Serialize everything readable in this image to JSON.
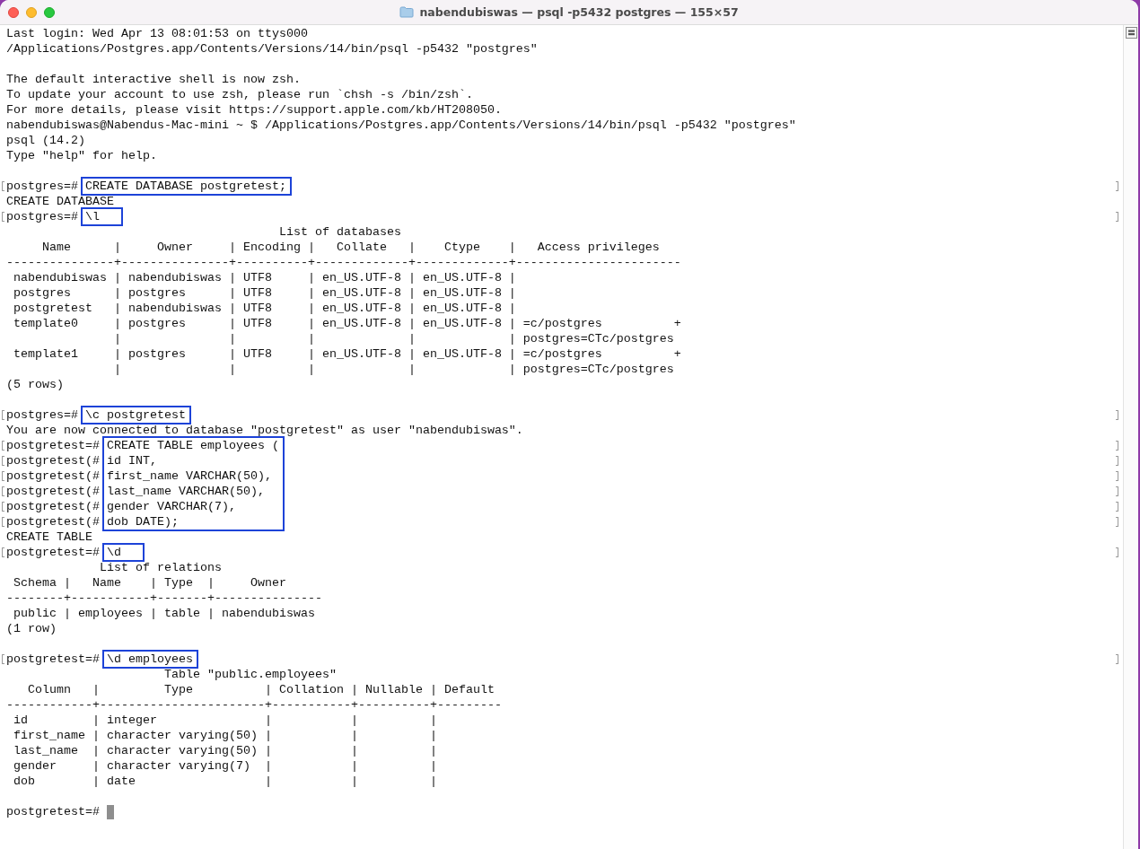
{
  "window": {
    "title": "nabendubiswas — psql -p5432 postgres — 155×57"
  },
  "lines": [
    {
      "kind": "output",
      "text": "Last login: Wed Apr 13 08:01:53 on ttys000"
    },
    {
      "kind": "output",
      "text": "/Applications/Postgres.app/Contents/Versions/14/bin/psql -p5432 \"postgres\""
    },
    {
      "kind": "blank"
    },
    {
      "kind": "output",
      "text": "The default interactive shell is now zsh."
    },
    {
      "kind": "output",
      "text": "To update your account to use zsh, please run `chsh -s /bin/zsh`."
    },
    {
      "kind": "output",
      "text": "For more details, please visit https://support.apple.com/kb/HT208050."
    },
    {
      "kind": "output",
      "text": "nabendubiswas@Nabendus-Mac-mini ~ $ /Applications/Postgres.app/Contents/Versions/14/bin/psql -p5432 \"postgres\""
    },
    {
      "kind": "output",
      "text": "psql (14.2)"
    },
    {
      "kind": "output",
      "text": "Type \"help\" for help."
    },
    {
      "kind": "blank"
    },
    {
      "kind": "command",
      "boxed": true,
      "rows": [
        {
          "prompt": "postgres=#",
          "input": "CREATE DATABASE postgretest;"
        }
      ]
    },
    {
      "kind": "output",
      "text": "CREATE DATABASE"
    },
    {
      "kind": "command",
      "boxed": true,
      "rows": [
        {
          "prompt": "postgres=#",
          "input": "\\l"
        }
      ]
    },
    {
      "kind": "output",
      "text": "                                      List of databases"
    },
    {
      "kind": "output",
      "text": "     Name      |     Owner     | Encoding |   Collate   |    Ctype    |   Access privileges"
    },
    {
      "kind": "output",
      "text": "---------------+---------------+----------+-------------+-------------+-----------------------"
    },
    {
      "kind": "output",
      "text": " nabendubiswas | nabendubiswas | UTF8     | en_US.UTF-8 | en_US.UTF-8 |"
    },
    {
      "kind": "output",
      "text": " postgres      | postgres      | UTF8     | en_US.UTF-8 | en_US.UTF-8 |"
    },
    {
      "kind": "output",
      "text": " postgretest   | nabendubiswas | UTF8     | en_US.UTF-8 | en_US.UTF-8 |"
    },
    {
      "kind": "output",
      "text": " template0     | postgres      | UTF8     | en_US.UTF-8 | en_US.UTF-8 | =c/postgres          +"
    },
    {
      "kind": "output",
      "text": "               |               |          |             |             | postgres=CTc/postgres"
    },
    {
      "kind": "output",
      "text": " template1     | postgres      | UTF8     | en_US.UTF-8 | en_US.UTF-8 | =c/postgres          +"
    },
    {
      "kind": "output",
      "text": "               |               |          |             |             | postgres=CTc/postgres"
    },
    {
      "kind": "output",
      "text": "(5 rows)"
    },
    {
      "kind": "blank"
    },
    {
      "kind": "command",
      "boxed": true,
      "rows": [
        {
          "prompt": "postgres=#",
          "input": "\\c postgretest"
        }
      ]
    },
    {
      "kind": "output",
      "text": "You are now connected to database \"postgretest\" as user \"nabendubiswas\"."
    },
    {
      "kind": "command",
      "boxed": true,
      "rows": [
        {
          "prompt": "postgretest=#",
          "input": "CREATE TABLE employees ("
        },
        {
          "prompt": "postgretest(#",
          "input": "id INT,"
        },
        {
          "prompt": "postgretest(#",
          "input": "first_name VARCHAR(50),"
        },
        {
          "prompt": "postgretest(#",
          "input": "last_name VARCHAR(50),"
        },
        {
          "prompt": "postgretest(#",
          "input": "gender VARCHAR(7),"
        },
        {
          "prompt": "postgretest(#",
          "input": "dob DATE);"
        }
      ]
    },
    {
      "kind": "output",
      "text": "CREATE TABLE"
    },
    {
      "kind": "command",
      "boxed": true,
      "rows": [
        {
          "prompt": "postgretest=#",
          "input": "\\d"
        }
      ]
    },
    {
      "kind": "output",
      "text": "             List of relations"
    },
    {
      "kind": "output",
      "text": " Schema |   Name    | Type  |     Owner"
    },
    {
      "kind": "output",
      "text": "--------+-----------+-------+---------------"
    },
    {
      "kind": "output",
      "text": " public | employees | table | nabendubiswas"
    },
    {
      "kind": "output",
      "text": "(1 row)"
    },
    {
      "kind": "blank"
    },
    {
      "kind": "command",
      "boxed": true,
      "rows": [
        {
          "prompt": "postgretest=#",
          "input": "\\d employees"
        }
      ]
    },
    {
      "kind": "output",
      "text": "                      Table \"public.employees\""
    },
    {
      "kind": "output",
      "text": "   Column   |         Type          | Collation | Nullable | Default"
    },
    {
      "kind": "output",
      "text": "------------+-----------------------+-----------+----------+---------"
    },
    {
      "kind": "output",
      "text": " id         | integer               |           |          |"
    },
    {
      "kind": "output",
      "text": " first_name | character varying(50) |           |          |"
    },
    {
      "kind": "output",
      "text": " last_name  | character varying(50) |           |          |"
    },
    {
      "kind": "output",
      "text": " gender     | character varying(7)  |           |          |"
    },
    {
      "kind": "output",
      "text": " dob        | date                  |           |          |"
    },
    {
      "kind": "blank"
    },
    {
      "kind": "prompt",
      "prompt": "postgretest=#"
    }
  ]
}
